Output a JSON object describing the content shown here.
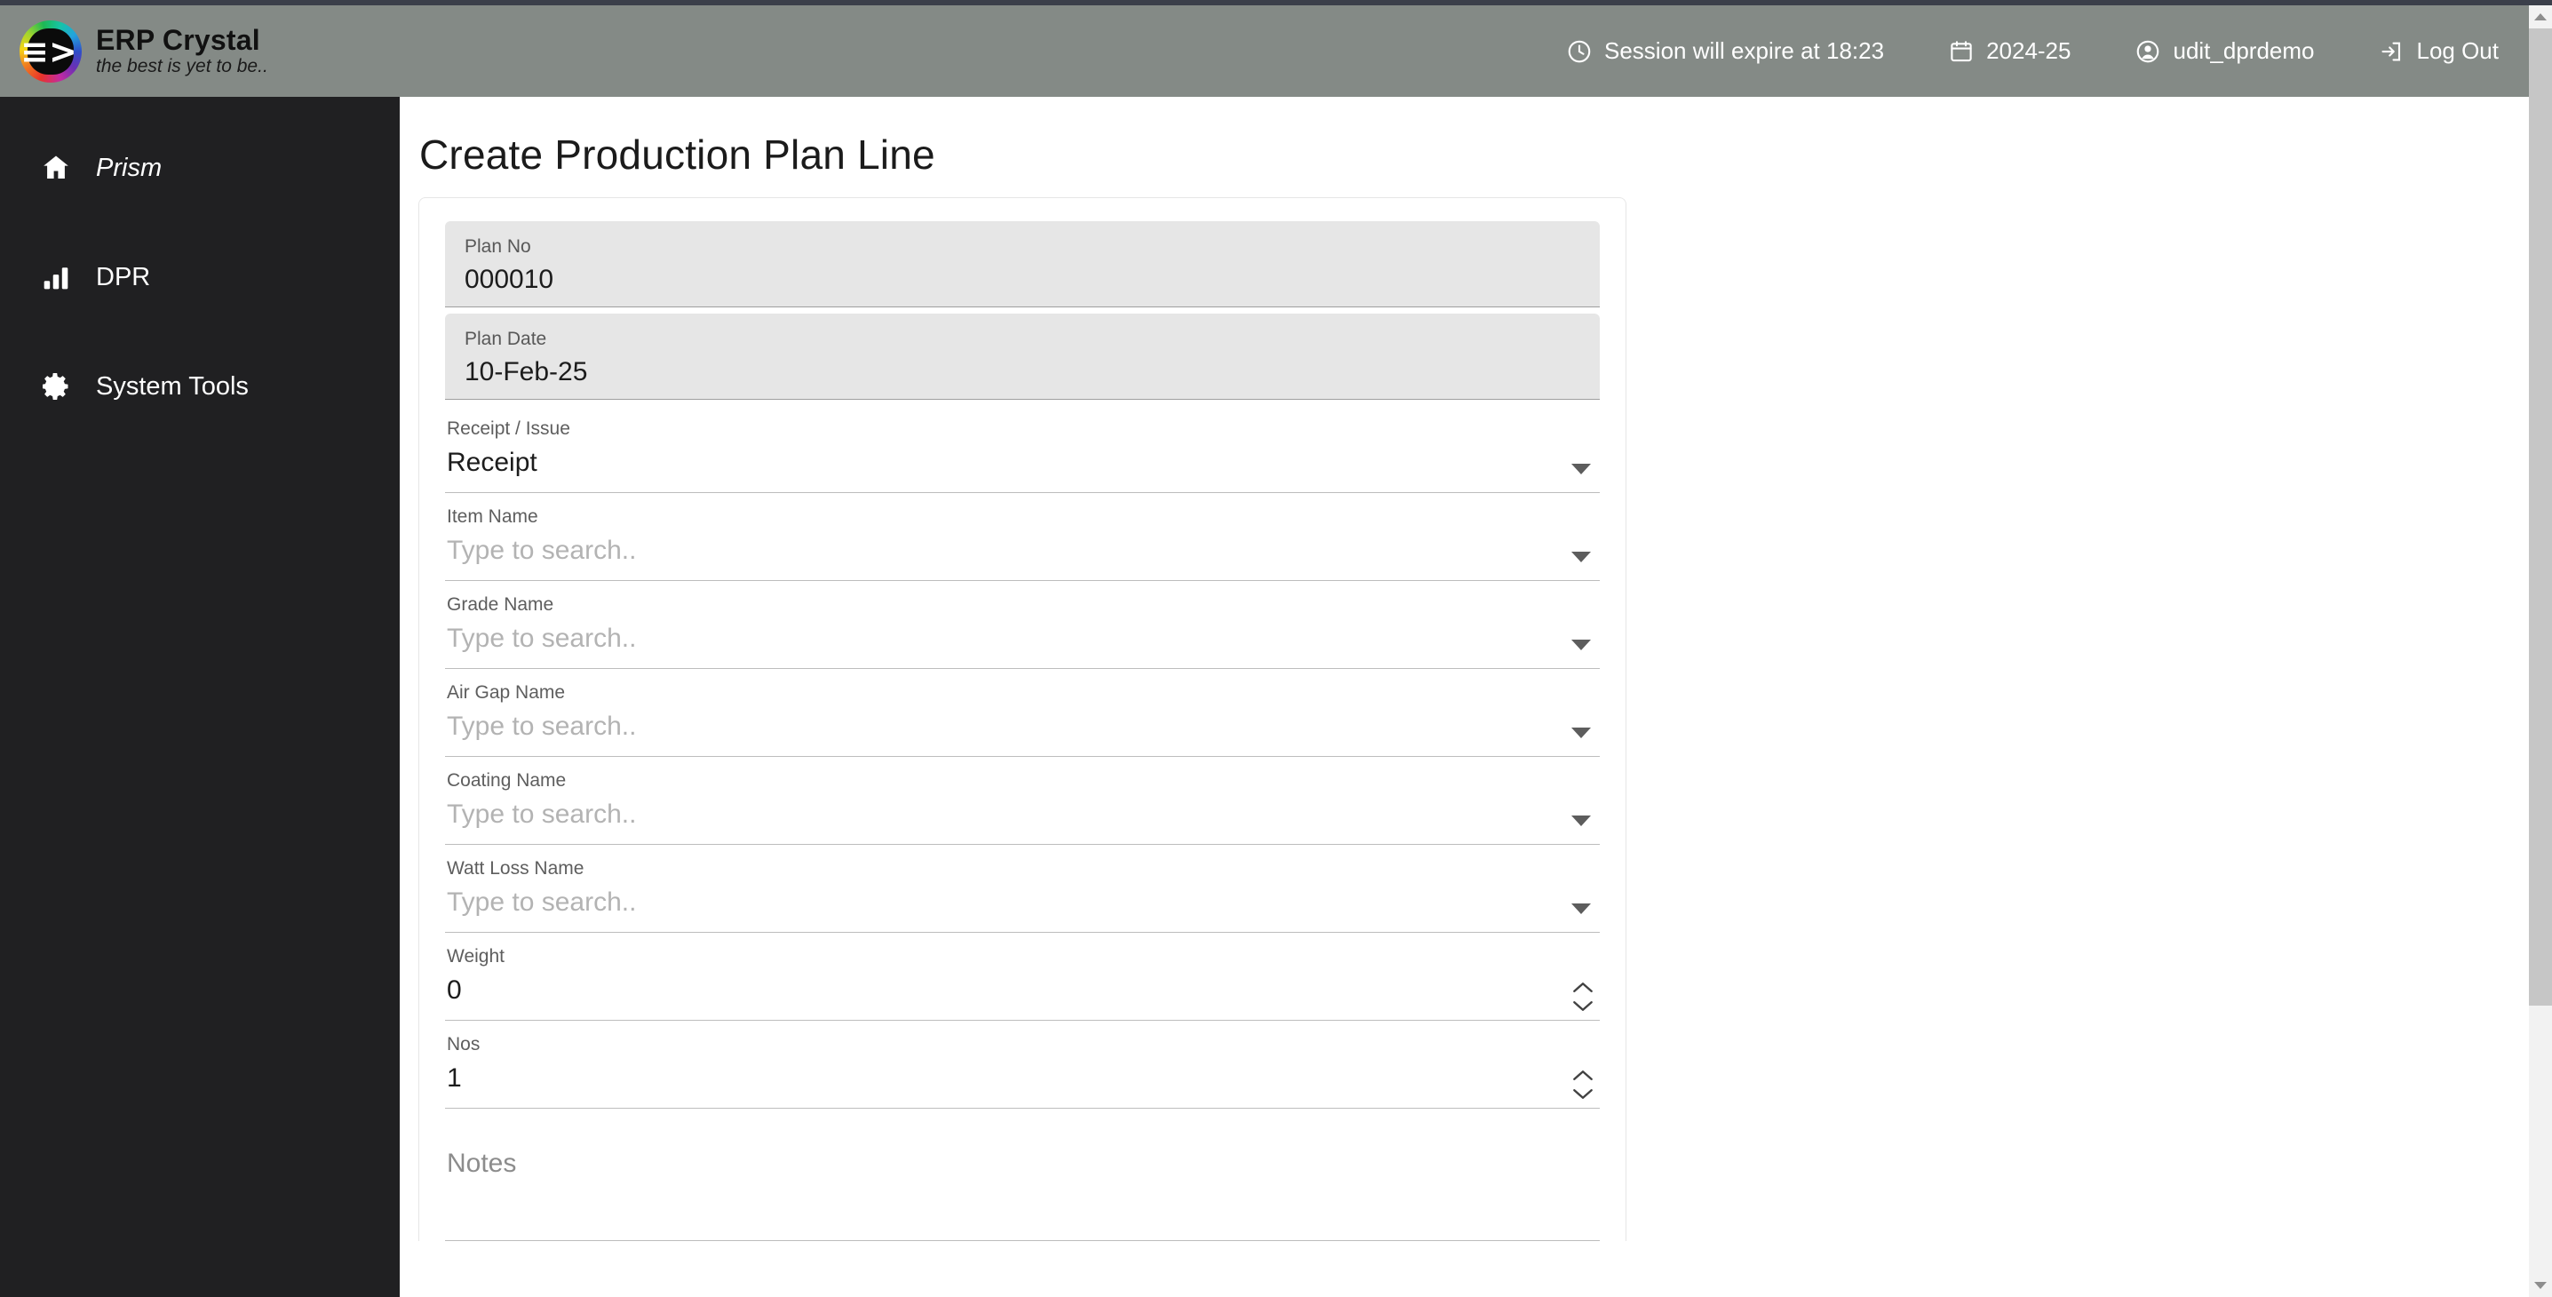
{
  "brand": {
    "name": "ERP Crystal",
    "tagline": "the best is yet to be..",
    "logo_icon": "erp-crystal-logo"
  },
  "header": {
    "session": {
      "icon": "clock-icon",
      "label": "Session will expire at 18:23"
    },
    "fiscal_year": {
      "icon": "calendar-icon",
      "label": "2024-25"
    },
    "user": {
      "icon": "user-icon",
      "label": "udit_dprdemo"
    },
    "logout": {
      "icon": "logout-icon",
      "label": "Log Out"
    }
  },
  "sidebar": {
    "items": [
      {
        "icon": "home-icon",
        "label": "Prism",
        "italic": true
      },
      {
        "icon": "bar-chart-icon",
        "label": "DPR",
        "italic": false
      },
      {
        "icon": "gear-icon",
        "label": "System Tools",
        "italic": false
      }
    ]
  },
  "main": {
    "page_title": "Create Production Plan Line",
    "fields": {
      "plan_no": {
        "label": "Plan No",
        "value": "000010"
      },
      "plan_date": {
        "label": "Plan Date",
        "value": "10-Feb-25"
      },
      "receipt_issue": {
        "label": "Receipt / Issue",
        "value": "Receipt"
      },
      "item_name": {
        "label": "Item Name",
        "placeholder": "Type to search.."
      },
      "grade_name": {
        "label": "Grade Name",
        "placeholder": "Type to search.."
      },
      "air_gap_name": {
        "label": "Air Gap Name",
        "placeholder": "Type to search.."
      },
      "coating_name": {
        "label": "Coating Name",
        "placeholder": "Type to search.."
      },
      "watt_loss_name": {
        "label": "Watt Loss Name",
        "placeholder": "Type to search.."
      },
      "weight": {
        "label": "Weight",
        "value": "0"
      },
      "nos": {
        "label": "Nos",
        "value": "1"
      },
      "notes": {
        "placeholder": "Notes"
      }
    }
  },
  "colors": {
    "header_bg": "#848a86",
    "sidebar_bg": "#202022",
    "top_strip": "#3b3f4a",
    "field_filled_bg": "#e6e6e6",
    "underline": "#bdbdbd"
  }
}
